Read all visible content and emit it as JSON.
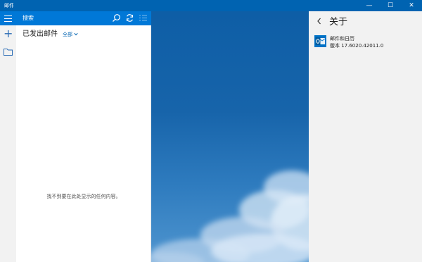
{
  "window": {
    "title": "邮件",
    "controls": {
      "minimize": "—",
      "maximize": "☐",
      "close": "✕"
    }
  },
  "rail": {
    "icons": [
      "hamburger-icon",
      "plus-icon",
      "folder-icon"
    ]
  },
  "search": {
    "label": "搜索",
    "icons": [
      "search-icon",
      "sync-icon",
      "select-mode-icon"
    ]
  },
  "folder": {
    "title": "已发出邮件",
    "filter_label": "全部",
    "empty_message": "找不到要在此处显示的任何内容。"
  },
  "about": {
    "title": "关于",
    "app_name": "邮件和日历",
    "version": "版本 17.6020.42011.0",
    "icon": "outlook-icon"
  },
  "colors": {
    "accent": "#0078d7",
    "titlebar": "#0063b1",
    "pane_bg": "#f2f2f2"
  }
}
